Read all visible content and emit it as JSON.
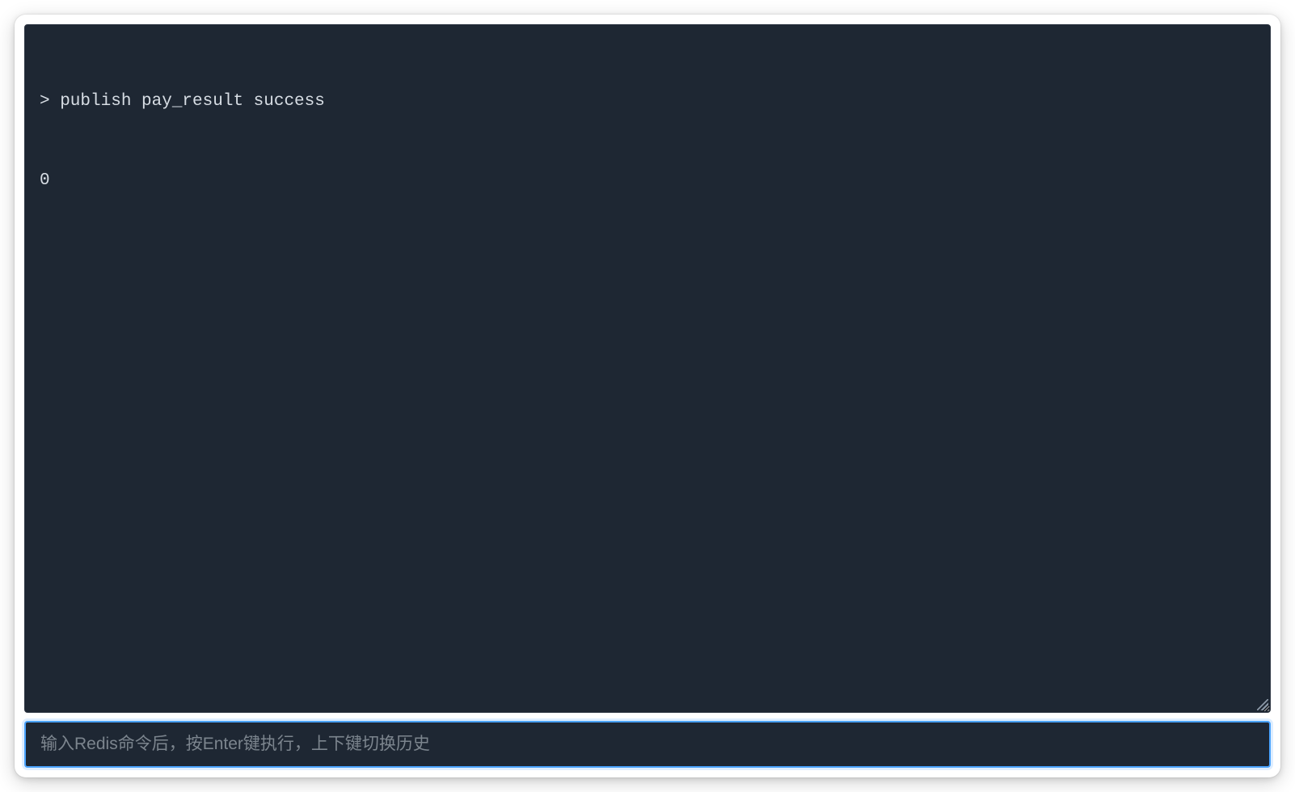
{
  "terminal": {
    "lines": [
      "> publish pay_result success",
      "0"
    ]
  },
  "input": {
    "value": "",
    "placeholder": "输入Redis命令后，按Enter键执行，上下键切换历史"
  }
}
